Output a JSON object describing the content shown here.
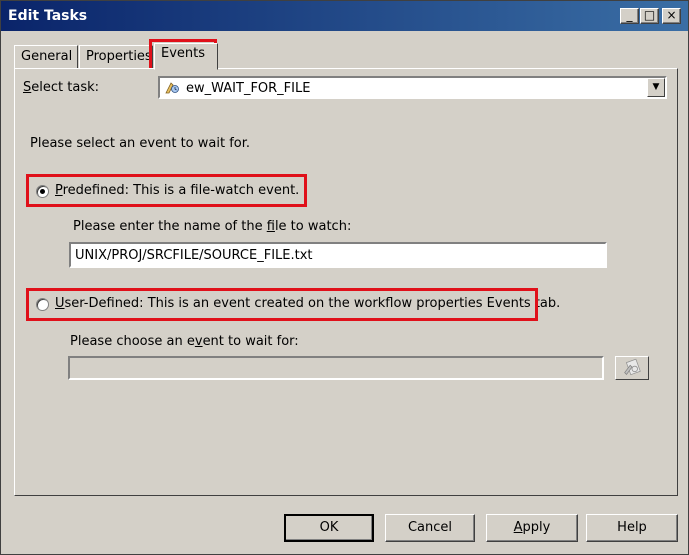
{
  "window": {
    "title": "Edit Tasks",
    "controls": {
      "minimize": "_",
      "maximize": "□",
      "close": "×"
    }
  },
  "tabs": [
    {
      "label": "General"
    },
    {
      "label": "Properties"
    },
    {
      "label": "Events",
      "active": true
    }
  ],
  "select_task": {
    "label": "Select task:",
    "accesskey": "S",
    "label_rest": "elect task:",
    "value": "ew_WAIT_FOR_FILE",
    "icon": "event-wait-task-icon",
    "arrow": "▼"
  },
  "instruction": "Please select an event to wait for.",
  "predefined": {
    "checked": true,
    "accesskey": "P",
    "label_rest": "redefined: This is a file-watch event.",
    "file_prompt_pre": "Please enter the name of the ",
    "file_prompt_key": "f",
    "file_prompt_post": "ile to watch:",
    "file_value": "UNIX/PROJ/SRCFILE/SOURCE_FILE.txt"
  },
  "user_defined": {
    "checked": false,
    "accesskey": "U",
    "label_rest": "ser-Defined: This is an event created on the workflow properties Events tab.",
    "event_prompt_pre": "Please choose an e",
    "event_prompt_key": "v",
    "event_prompt_post": "ent to wait for:",
    "event_value": "",
    "browse_icon": "browse-events-icon"
  },
  "buttons": {
    "ok": "OK",
    "cancel": "Cancel",
    "apply_key": "A",
    "apply_rest": "pply",
    "help": "Help"
  },
  "colors": {
    "titlebar_start": "#0a246a",
    "titlebar_end": "#3a6ea5",
    "dialog_face": "#d4d0c8",
    "highlight_box": "#e0101a"
  }
}
